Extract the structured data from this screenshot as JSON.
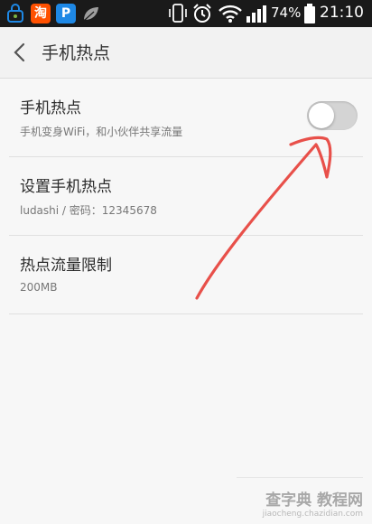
{
  "status_bar": {
    "notification_icons": [
      {
        "icon": "bag-lock-icon",
        "color": "#1e88e5"
      },
      {
        "icon": "taobao-icon",
        "label": "淘",
        "color": "#ff5000"
      },
      {
        "icon": "parking-icon",
        "label": "P",
        "color": "#1e88e5"
      },
      {
        "icon": "leaf-icon",
        "color": "#9e9e9e"
      }
    ],
    "battery_percent": "74%",
    "time": "21:10"
  },
  "header": {
    "title": "手机热点"
  },
  "settings": {
    "hotspot": {
      "title": "手机热点",
      "subtitle": "手机变身WiFi，和小伙伴共享流量",
      "enabled": false
    },
    "configure": {
      "title": "设置手机热点",
      "subtitle": "ludashi / 密码：12345678"
    },
    "data_limit": {
      "title": "热点流量限制",
      "subtitle": "200MB"
    }
  },
  "watermark": {
    "main": "查字典 教程网",
    "sub": "jiaocheng.chazidian.com"
  },
  "colors": {
    "status_bar_bg": "#1a1a1a",
    "background": "#f7f7f7",
    "toggle_off": "#d4d4d4",
    "annotation_stroke": "#e8504a"
  }
}
